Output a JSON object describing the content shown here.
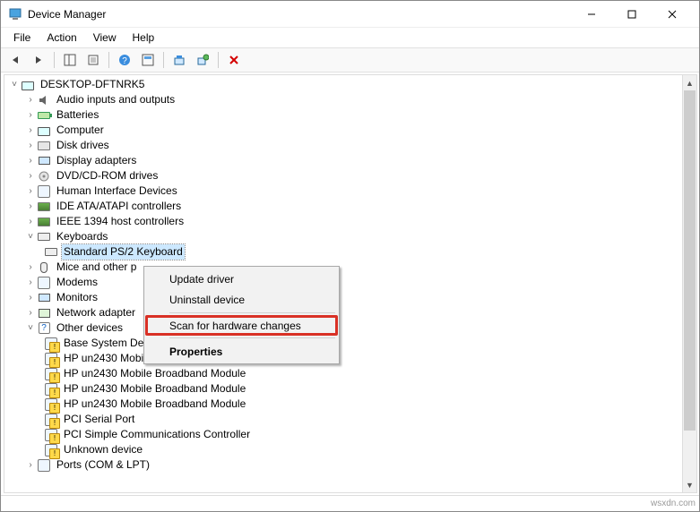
{
  "window": {
    "title": "Device Manager"
  },
  "menubar": {
    "file": "File",
    "action": "Action",
    "view": "View",
    "help": "Help"
  },
  "winctrl": {
    "min": "—",
    "max": "☐",
    "close": "✕"
  },
  "root": "DESKTOP-DFTNRK5",
  "categories": [
    {
      "label": "Audio inputs and outputs",
      "icon": "audio-icon"
    },
    {
      "label": "Batteries",
      "icon": "battery-icon"
    },
    {
      "label": "Computer",
      "icon": "computer-icon"
    },
    {
      "label": "Disk drives",
      "icon": "disk-icon"
    },
    {
      "label": "Display adapters",
      "icon": "display-icon"
    },
    {
      "label": "DVD/CD-ROM drives",
      "icon": "optical-icon"
    },
    {
      "label": "Human Interface Devices",
      "icon": "hid-icon"
    },
    {
      "label": "IDE ATA/ATAPI controllers",
      "icon": "storage-controller-icon"
    },
    {
      "label": "IEEE 1394 host controllers",
      "icon": "firewire-icon"
    }
  ],
  "keyboards": {
    "label": "Keyboards",
    "device": "Standard PS/2 Keyboard"
  },
  "below_kb": [
    {
      "label": "Mice and other p",
      "exp": true
    },
    {
      "label": "Modems",
      "exp": true
    },
    {
      "label": "Monitors",
      "exp": true
    },
    {
      "label": "Network adapter",
      "exp": true
    }
  ],
  "other_devices": {
    "label": "Other devices",
    "items": [
      "Base System De",
      "HP un2430 Mobile Broadband Module",
      "HP un2430 Mobile Broadband Module",
      "HP un2430 Mobile Broadband Module",
      "HP un2430 Mobile Broadband Module",
      "PCI Serial Port",
      "PCI Simple Communications Controller",
      "Unknown device"
    ],
    "truncated": "Ports (COM & LPT)"
  },
  "context_menu": {
    "update": "Update driver",
    "uninstall": "Uninstall device",
    "scan": "Scan for hardware changes",
    "properties": "Properties"
  },
  "watermark": "wsxdn.com"
}
